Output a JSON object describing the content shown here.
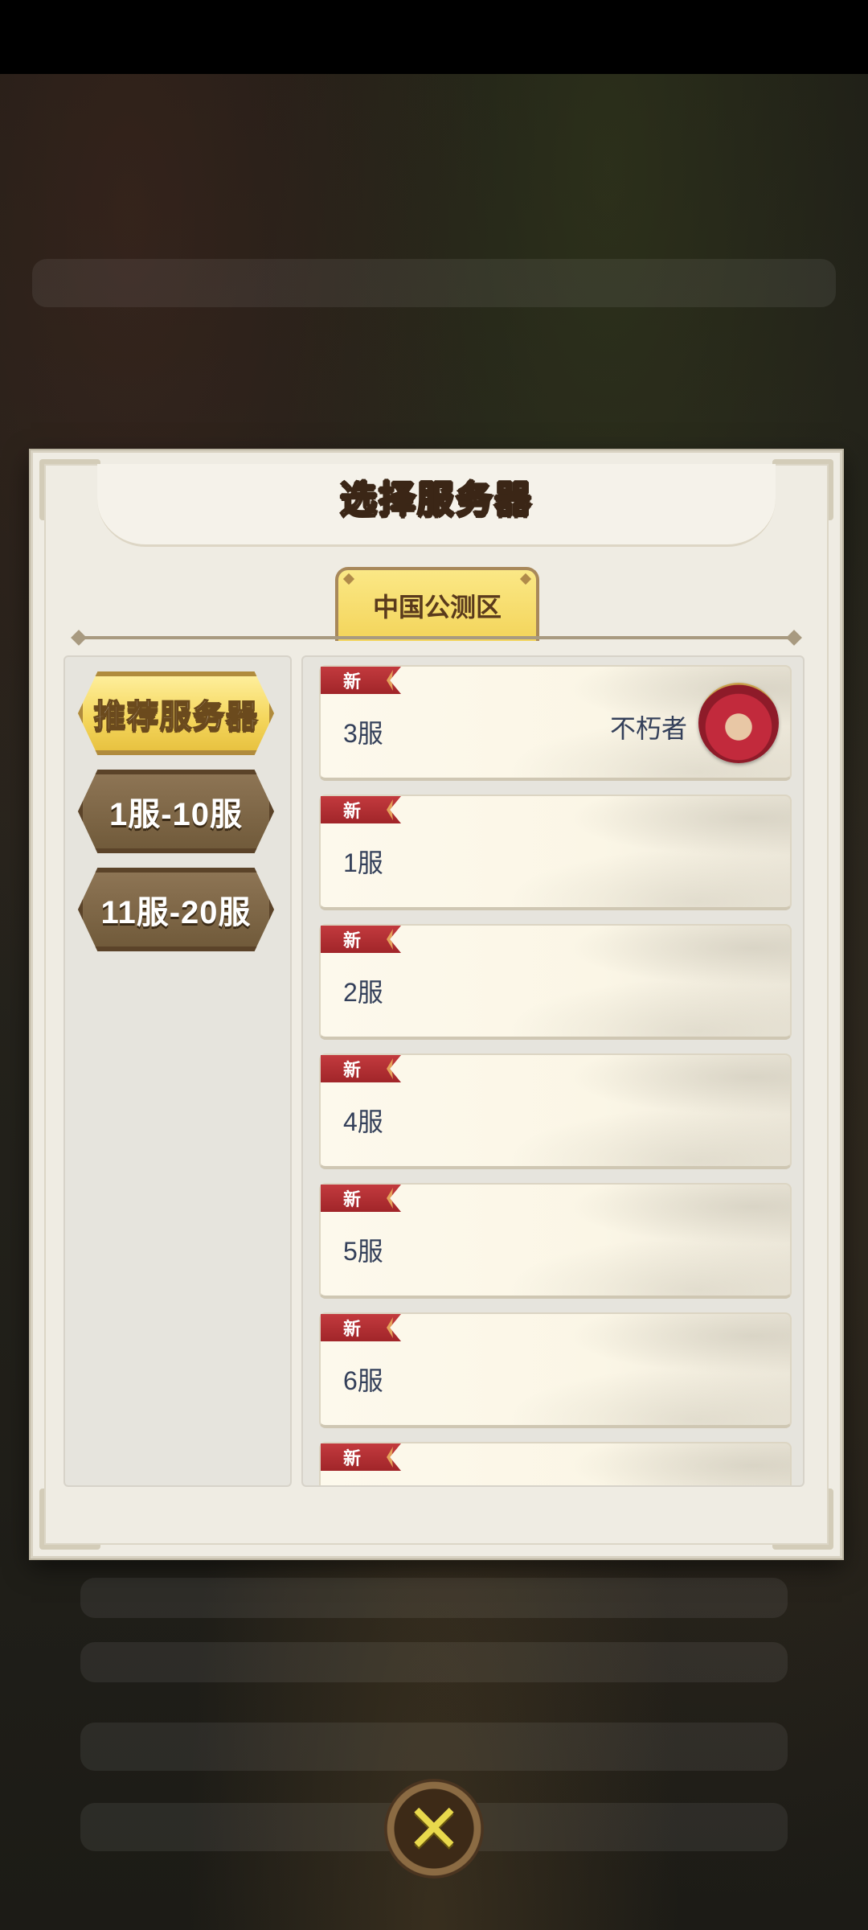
{
  "dialog": {
    "title": "选择服务器",
    "region_tab": "中国公测区"
  },
  "categories": [
    {
      "label": "推荐服务器",
      "active": true
    },
    {
      "label": "1服-10服",
      "active": false
    },
    {
      "label": "11服-20服",
      "active": false
    }
  ],
  "servers": [
    {
      "badge": "新",
      "name": "3服",
      "player": "不朽者",
      "has_avatar": true
    },
    {
      "badge": "新",
      "name": "1服",
      "player": ""
    },
    {
      "badge": "新",
      "name": "2服",
      "player": ""
    },
    {
      "badge": "新",
      "name": "4服",
      "player": ""
    },
    {
      "badge": "新",
      "name": "5服",
      "player": ""
    },
    {
      "badge": "新",
      "name": "6服",
      "player": ""
    },
    {
      "badge": "新",
      "name": "",
      "player": ""
    }
  ],
  "close_icon": "close-icon",
  "colors": {
    "accent_yellow": "#f5d75e",
    "badge_red": "#c33a3e",
    "brown": "#6f5939"
  }
}
